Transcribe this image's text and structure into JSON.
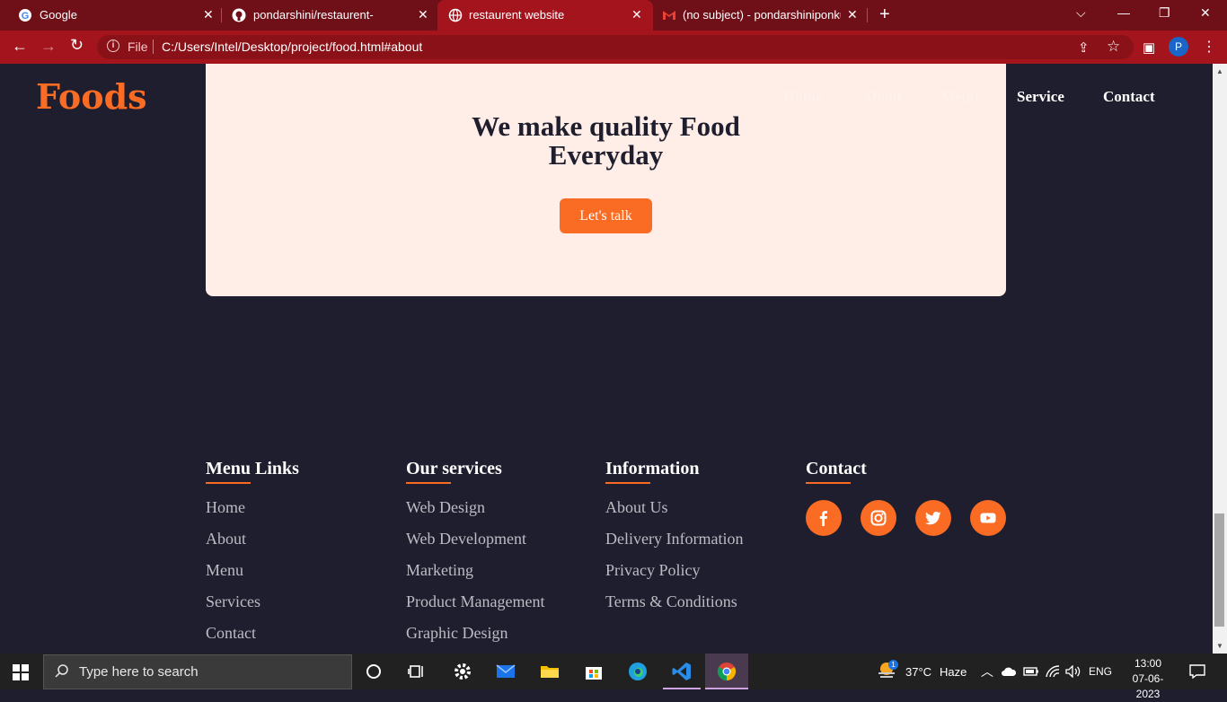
{
  "browser": {
    "tabs": [
      {
        "title": "Google",
        "active": false
      },
      {
        "title": "pondarshini/restaurent-",
        "active": false
      },
      {
        "title": "restaurent website",
        "active": true
      },
      {
        "title": "(no subject) - pondarshiniponkun",
        "active": false
      }
    ],
    "address": {
      "scheme_label": "File",
      "url": "C:/Users/Intel/Desktop/project/food.html#about"
    },
    "profile_initial": "P"
  },
  "site": {
    "logo": "Foods",
    "nav": [
      "Home",
      "About",
      "Menu",
      "Service",
      "Contact"
    ],
    "hero": {
      "title_line1": "We make quality Food",
      "title_line2": "Everyday",
      "cta": "Let's talk"
    },
    "footer": {
      "menu_links": {
        "heading": "Menu Links",
        "items": [
          "Home",
          "About",
          "Menu",
          "Services",
          "Contact"
        ]
      },
      "services": {
        "heading": "Our services",
        "items": [
          "Web Design",
          "Web Development",
          "Marketing",
          "Product Management",
          "Graphic Design"
        ]
      },
      "information": {
        "heading": "Information",
        "items": [
          "About Us",
          "Delivery Information",
          "Privacy Policy",
          "Terms & Conditions"
        ]
      },
      "contact": {
        "heading": "Contact",
        "social": [
          "facebook-icon",
          "instagram-icon",
          "twitter-icon",
          "youtube-icon"
        ]
      }
    },
    "accent_color": "#fa6b23",
    "background_color": "#1f1e2e"
  },
  "taskbar": {
    "search_placeholder": "Type here to search",
    "weather": {
      "temp": "37°C",
      "condition": "Haze",
      "badge": "1"
    },
    "language": "ENG",
    "time": "13:00",
    "date": "07-06-2023"
  }
}
